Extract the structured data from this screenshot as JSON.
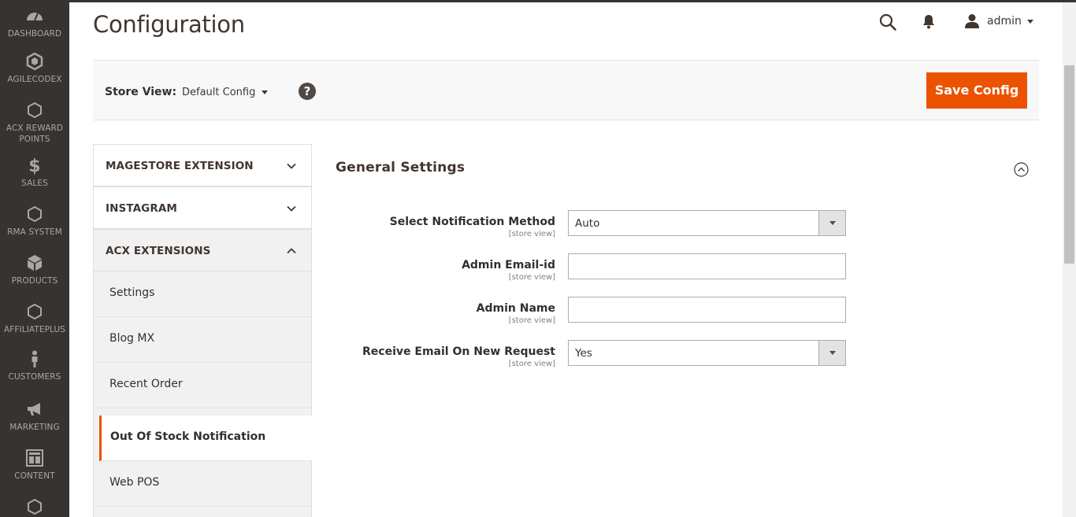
{
  "sidebar": {
    "items": [
      {
        "label": "DASHBOARD",
        "icon": "dashboard-icon"
      },
      {
        "label": "AGILECODEX",
        "icon": "agilecodex-icon"
      },
      {
        "label": "ACX REWARD POINTS",
        "icon": "hexagon-icon"
      },
      {
        "label": "SALES",
        "icon": "dollar-icon"
      },
      {
        "label": "RMA SYSTEM",
        "icon": "hexagon-icon"
      },
      {
        "label": "PRODUCTS",
        "icon": "box-icon"
      },
      {
        "label": "AFFILIATEPLUS",
        "icon": "hexagon-icon"
      },
      {
        "label": "CUSTOMERS",
        "icon": "person-icon"
      },
      {
        "label": "MARKETING",
        "icon": "megaphone-icon"
      },
      {
        "label": "CONTENT",
        "icon": "layout-icon"
      }
    ]
  },
  "header": {
    "title": "Configuration",
    "user_name": "admin"
  },
  "store_bar": {
    "label": "Store View:",
    "value": "Default Config",
    "help": "?",
    "save_label": "Save Config"
  },
  "tabs": {
    "groups": [
      {
        "label": "MAGESTORE EXTENSION",
        "state": "collapsed"
      },
      {
        "label": "INSTAGRAM",
        "state": "collapsed"
      },
      {
        "label": "ACX EXTENSIONS",
        "state": "expanded"
      }
    ],
    "items": [
      {
        "label": "Settings"
      },
      {
        "label": "Blog MX"
      },
      {
        "label": "Recent Order"
      },
      {
        "label": "Out Of Stock Notification",
        "active": true
      },
      {
        "label": "Web POS"
      }
    ]
  },
  "section": {
    "title": "General Settings",
    "fields": [
      {
        "label": "Select Notification Method",
        "scope": "[store view]",
        "type": "select",
        "value": "Auto"
      },
      {
        "label": "Admin Email-id",
        "scope": "[store view]",
        "type": "text",
        "value": ""
      },
      {
        "label": "Admin Name",
        "scope": "[store view]",
        "type": "text",
        "value": ""
      },
      {
        "label": "Receive Email On New Request",
        "scope": "[store view]",
        "type": "select",
        "value": "Yes"
      }
    ]
  },
  "colors": {
    "sidebar_bg": "#373330",
    "accent": "#eb5202",
    "text_dark": "#41362f"
  }
}
